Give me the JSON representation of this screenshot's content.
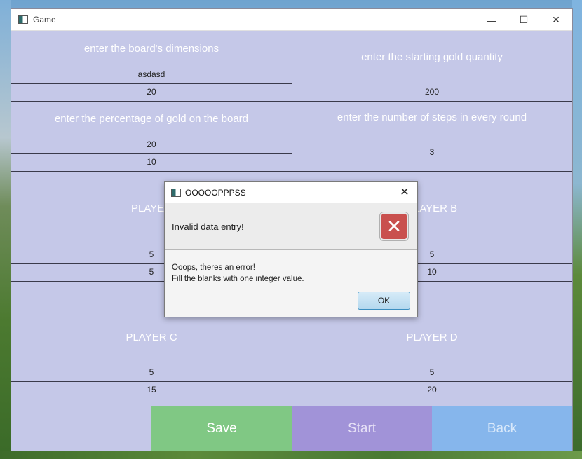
{
  "window": {
    "title": "Game",
    "controls": {
      "minimize": "—",
      "maximize": "☐",
      "close": "✕"
    }
  },
  "form": {
    "board_dimensions": {
      "label": "enter the board's dimensions",
      "value1": "asdasd",
      "value2": "20"
    },
    "starting_gold": {
      "label": "enter the starting gold quantity",
      "value": "200"
    },
    "gold_percentage": {
      "label": "enter the percentage of gold on the board",
      "value1": "20",
      "value2": "10"
    },
    "steps": {
      "label": "enter the number of steps in every round",
      "value": "3"
    },
    "player_a": {
      "label": "PLAYER",
      "value1": "5",
      "value2": "5"
    },
    "player_b": {
      "label": "PLAYER B",
      "value1": "5",
      "value2": "10"
    },
    "player_c": {
      "label": "PLAYER C",
      "value1": "5",
      "value2": "15"
    },
    "player_d": {
      "label": "PLAYER D",
      "value1": "5",
      "value2": "20"
    }
  },
  "buttons": {
    "save": "Save",
    "start": "Start",
    "back": "Back"
  },
  "dialog": {
    "title": "OOOOOPPPSS",
    "close": "✕",
    "header": "Invalid data entry!",
    "icon": "error-icon",
    "message_line1": "Ooops, theres an error!",
    "message_line2": "Fill the blanks with one integer value.",
    "ok": "OK"
  }
}
